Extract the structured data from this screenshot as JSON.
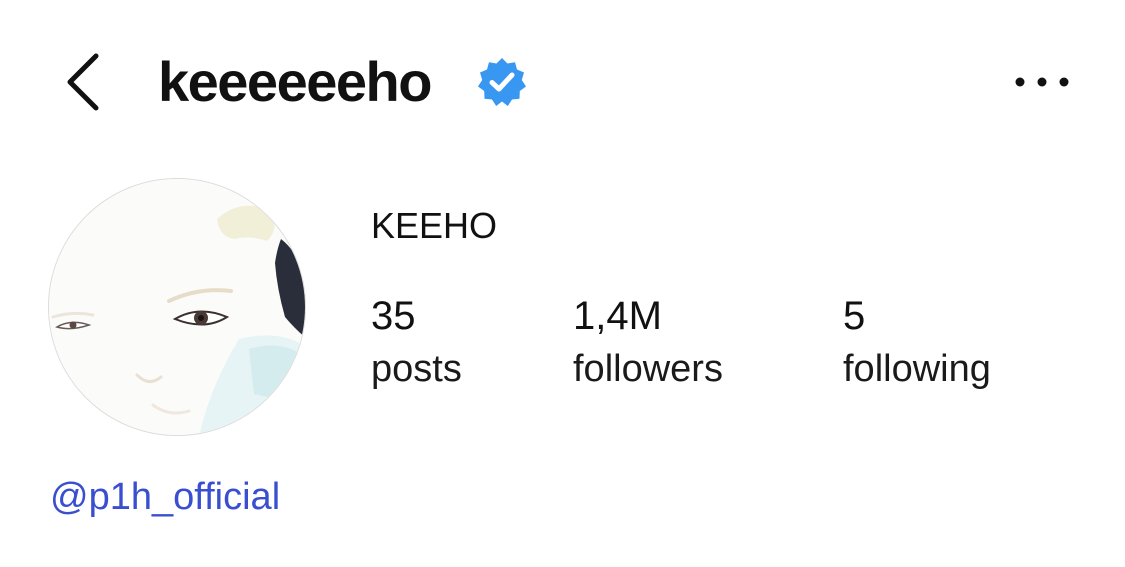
{
  "header": {
    "back_icon": "chevron-left-icon",
    "username": "keeeeeeho",
    "verified_icon": "verified-badge-icon",
    "more_icon": "more-horizontal-icon"
  },
  "profile": {
    "display_name": "KEEHO",
    "avatar": "profile-photo"
  },
  "stats": [
    {
      "value": "35",
      "label": "posts"
    },
    {
      "value": "1,4M",
      "label": "followers"
    },
    {
      "value": "5",
      "label": "following"
    }
  ],
  "linked_account": "@p1h_official",
  "colors": {
    "verified": "#3897f0",
    "link": "#3a4fd0",
    "text": "#111111"
  }
}
